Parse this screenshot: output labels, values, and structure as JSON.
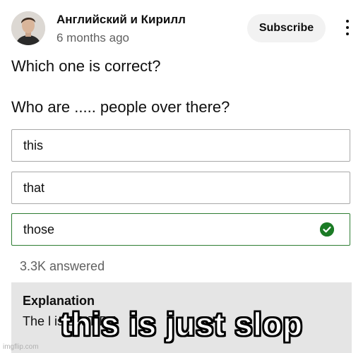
{
  "header": {
    "channel_name": "Английский и Кирилл",
    "timestamp": "6 months ago",
    "subscribe_label": "Subscribe"
  },
  "quiz": {
    "question_line1": "Which one is correct?",
    "question_line2": "Who are ..... people over there?",
    "options": [
      {
        "label": "this",
        "correct": false
      },
      {
        "label": "that",
        "correct": false
      },
      {
        "label": "those",
        "correct": true
      }
    ],
    "answered_count": "3.3K answered",
    "explanation_title": "Explanation",
    "explanation_text": "The l                 is  ER       T    PE"
  },
  "meme": {
    "caption": "this is just slop",
    "watermark": "imgflip.com"
  },
  "icons": {
    "check": "check-circle-icon",
    "menu": "more-vertical-icon"
  },
  "colors": {
    "correct_accent": "#1b7b25",
    "explanation_bg": "#e5e5e5",
    "subscribe_bg": "#f2f2f2"
  }
}
